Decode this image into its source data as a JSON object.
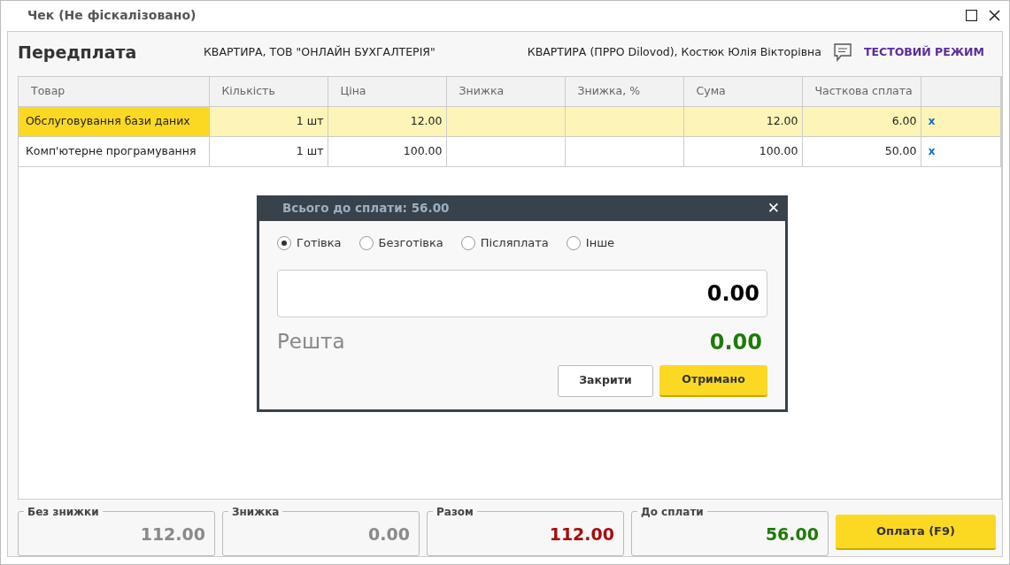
{
  "window": {
    "title": "Чек (Не фіскалізовано)"
  },
  "header": {
    "title": "Передплата",
    "company": "КВАРТИРА, ТОВ \"ОНЛАЙН БУХГАЛТЕРІЯ\"",
    "cashier": "КВАРТИРА (ПРРО Dilovod), Костюк Юлія Вікторівна",
    "mode": "ТЕСТОВИЙ РЕЖИМ"
  },
  "table": {
    "columns": [
      "Товар",
      "Кількість",
      "Ціна",
      "Знижка",
      "Знижка, %",
      "Сума",
      "Часткова сплата"
    ],
    "rows": [
      {
        "cells": [
          "Обслуговування бази даних",
          "1 шт",
          "12.00",
          "",
          "",
          "12.00",
          "6.00"
        ],
        "remove": "x",
        "selected": true
      },
      {
        "cells": [
          "Комп'ютерне програмування",
          "1 шт",
          "100.00",
          "",
          "",
          "100.00",
          "50.00"
        ],
        "remove": "x",
        "selected": false
      }
    ]
  },
  "dialog": {
    "title": "Всього до сплати: 56.00",
    "close": "✕",
    "methods": [
      {
        "label": "Готівка",
        "selected": true
      },
      {
        "label": "Безготівка",
        "selected": false
      },
      {
        "label": "Післяплата",
        "selected": false
      },
      {
        "label": "Інше",
        "selected": false
      }
    ],
    "amount": "0.00",
    "change_label": "Решта",
    "change": "0.00",
    "buttons": [
      {
        "label": "Закрити",
        "kind": "secondary"
      },
      {
        "label": "Отримано",
        "kind": "primary"
      }
    ]
  },
  "totals": [
    {
      "label": "Без знижки",
      "value": "112.00",
      "color": "#8a8a8a"
    },
    {
      "label": "Знижка",
      "value": "0.00",
      "color": "#8a8a8a"
    },
    {
      "label": "Разом",
      "value": "112.00",
      "color": "#a50e0e"
    },
    {
      "label": "До сплати",
      "value": "56.00",
      "color": "#1f7a0a"
    }
  ],
  "pay_button": "Оплата (F9)"
}
